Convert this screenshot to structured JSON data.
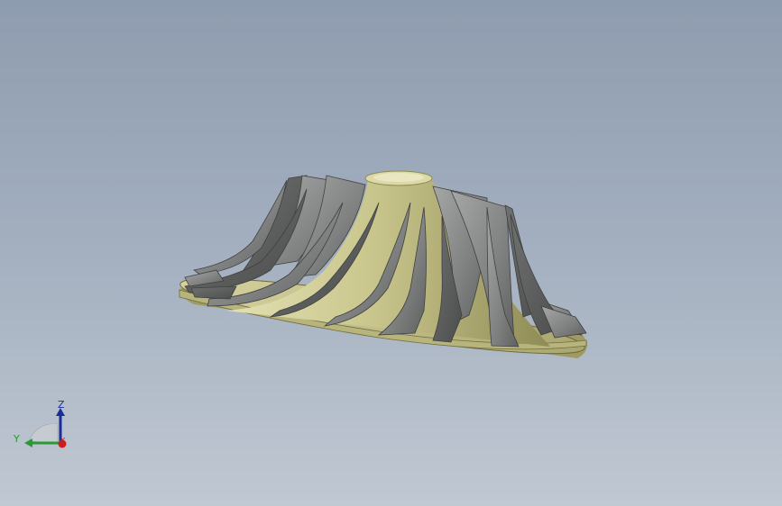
{
  "viewport": {
    "background_top": "#8e9caf",
    "background_bottom": "#c0c8d2"
  },
  "model": {
    "name": "compressor-impeller",
    "body_color": "#c9c68d",
    "blade_color": "#8a8b8b"
  },
  "triad": {
    "z_label": "Z",
    "y_label": "Y",
    "x_label": "X",
    "z_color": "#1a2e9a",
    "y_color": "#2a9a32",
    "x_color": "#cc1c1c"
  }
}
